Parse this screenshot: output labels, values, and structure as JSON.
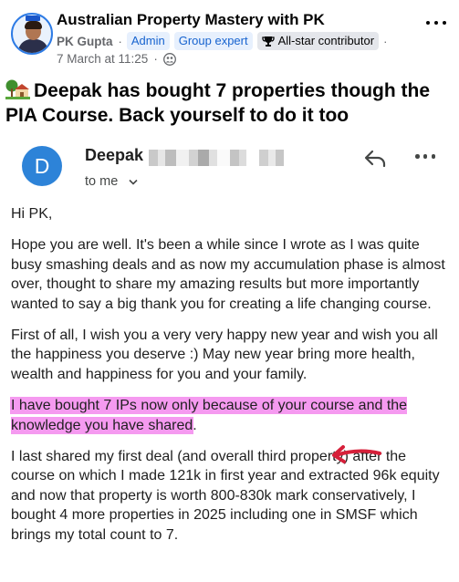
{
  "post": {
    "group_name": "Australian Property Mastery with PK",
    "author": "PK Gupta",
    "meta_separator": "·",
    "tags": [
      "Admin",
      "Group expert"
    ],
    "badge": "All-star contributor",
    "date": "7 March at 11:25",
    "date_separator": "·",
    "privacy_icon": "group-icon",
    "title": "Deepak has bought 7 properties though the PIA Course. Back yourself to do it too"
  },
  "email": {
    "sender_initial": "D",
    "sender_name": "Deepak",
    "recipient": "to me",
    "avatar_color": "#2d83d8",
    "greeting": "Hi PK,",
    "paragraphs": [
      "Hope you are well. It's been a while since I wrote as I was quite busy smashing deals and as now my accumulation phase is almost over, thought to share my amazing results but more importantly wanted to say a big thank you for creating a life changing course.",
      "First of all, I wish you a very very happy new year and wish you all the happiness you deserve :) May new year bring more health, wealth and happiness for you and your family."
    ],
    "highlighted": "I have bought 7 IPs now only because of your course and the knowledge you have shared",
    "highlighted_tail": ".",
    "last_paragraph": "I last shared my first deal (and overall third property) after the course on which I made 121k in first year and extracted 96k equity and now that property is worth 800-830k mark conservatively, I bought 4 more properties in 2025 including one in SMSF which brings my total count to 7."
  },
  "colors": {
    "highlight": "#f59af0",
    "arrow": "#d6203a",
    "tag_blue": "#1763cf"
  }
}
